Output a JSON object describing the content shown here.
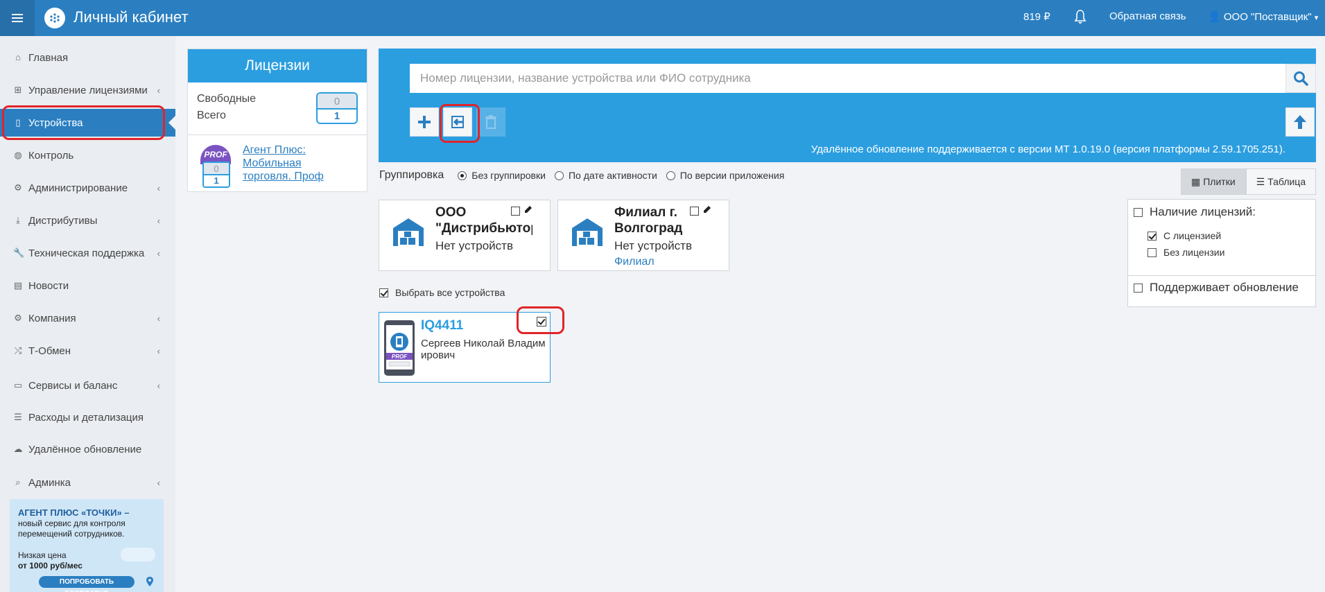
{
  "header": {
    "title": "Личный кабинет",
    "balance": "819 ₽",
    "feedback": "Обратная связь",
    "account": "ООО \"Поставщик\""
  },
  "sidebar": {
    "items": [
      {
        "label": "Главная",
        "icon": "home-icon",
        "has_children": false
      },
      {
        "label": "Управление лицензиями",
        "icon": "sitemap-icon",
        "has_children": true
      },
      {
        "label": "Устройства",
        "icon": "mobile-icon",
        "has_children": false,
        "active": true
      },
      {
        "label": "Контроль",
        "icon": "globe-icon",
        "has_children": false
      },
      {
        "label": "Администрирование",
        "icon": "gears-icon",
        "has_children": true
      },
      {
        "label": "Дистрибутивы",
        "icon": "download-icon",
        "has_children": true
      },
      {
        "label": "Техническая поддержка",
        "icon": "wrench-icon",
        "has_children": true
      },
      {
        "label": "Новости",
        "icon": "newspaper-icon",
        "has_children": false
      },
      {
        "label": "Компания",
        "icon": "gear-icon",
        "has_children": true
      },
      {
        "label": "Т-Обмен",
        "icon": "shuffle-icon",
        "has_children": true
      },
      {
        "label": "Сервисы и баланс",
        "icon": "money-icon",
        "has_children": true
      },
      {
        "label": "Расходы и детализация",
        "icon": "list-icon",
        "has_children": false
      },
      {
        "label": "Удалённое обновление",
        "icon": "cloud-upload-icon",
        "has_children": false
      },
      {
        "label": "Админка",
        "icon": "search-icon",
        "has_children": true
      }
    ],
    "promo": {
      "title": "АГЕНТ ПЛЮС «ТОЧКИ» –",
      "text": "новый сервис для контроля перемещений сотрудников.",
      "price_line": "Низкая цена",
      "price": "от 1000 руб/мес",
      "button": "ПОПРОБОВАТЬ БЕСПЛАТНО"
    }
  },
  "licenses": {
    "title": "Лицензии",
    "free_label": "Свободные",
    "total_label": "Всего",
    "free": "0",
    "total": "1",
    "product": {
      "badge": "PROF",
      "free": "0",
      "total": "1",
      "name": "Агент Плюс: Мобильная торговля. Проф"
    }
  },
  "search": {
    "placeholder": "Номер лицензии, название устройства или ФИО сотрудника",
    "value": ""
  },
  "remote_update_note": "Удалённое обновление поддерживается с версии МТ 1.0.19.0 (версия платформы 2.59.1705.251).",
  "grouping": {
    "label": "Группировка",
    "options": [
      "Без группировки",
      "По дате активности",
      "По версии приложения"
    ],
    "selected": "Без группировки"
  },
  "view": {
    "tiles": "Плитки",
    "table": "Таблица",
    "selected": "Плитки"
  },
  "orgs": [
    {
      "name": "ООО \"Дистрибьютор\"",
      "status": "Нет устройств",
      "type": ""
    },
    {
      "name": "Филиал г. Волгоград",
      "status": "Нет устройств",
      "type": "Филиал"
    }
  ],
  "filters": {
    "licenses_title": "Наличие лицензий:",
    "with_license": "С лицензией",
    "without_license": "Без лицензии",
    "with_license_checked": true,
    "without_license_checked": false,
    "supports_update": "Поддерживает обновление"
  },
  "select_all_label": "Выбрать все устройства",
  "devices": [
    {
      "name": "IQ4411",
      "owner": "Сергеев Николай Владимирович",
      "badge": "PROF",
      "checked": true
    }
  ],
  "colors": {
    "header": "#2b7fc1",
    "accent": "#2b9ee0",
    "highlight": "#e0242a"
  }
}
